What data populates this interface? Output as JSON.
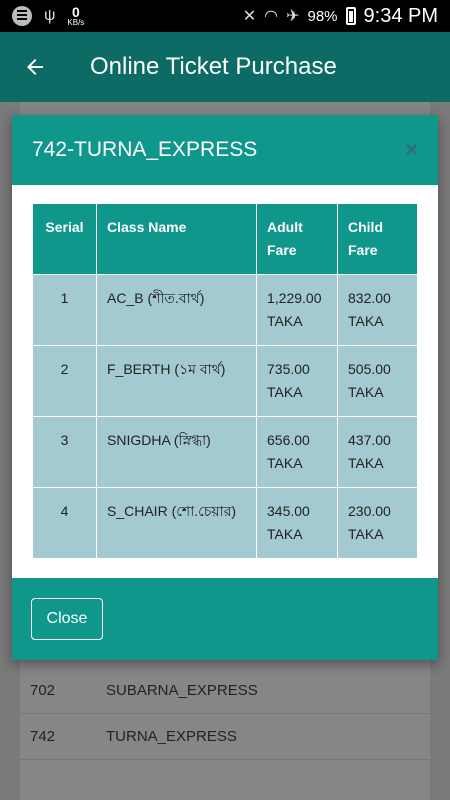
{
  "status_bar": {
    "data_speed_value": "0",
    "data_speed_unit": "KB/s",
    "battery": "98%",
    "time": "9:34 PM"
  },
  "app_bar": {
    "title": "Online Ticket Purchase"
  },
  "background_list": {
    "rows": [
      {
        "code": "702",
        "name": "SUBARNA_EXPRESS"
      },
      {
        "code": "742",
        "name": "TURNA_EXPRESS"
      }
    ]
  },
  "modal": {
    "title": "742-TURNA_EXPRESS",
    "close_x": "×",
    "table": {
      "headers": {
        "serial": "Serial",
        "class_name": "Class Name",
        "adult_fare": "Adult Fare",
        "child_fare": "Child Fare"
      },
      "rows": [
        {
          "serial": "1",
          "class_name": "AC_B (শীত.বার্থ)",
          "adult_fare": "1,229.00 TAKA",
          "child_fare": "832.00 TAKA"
        },
        {
          "serial": "2",
          "class_name": "F_BERTH (১ম বার্থ)",
          "adult_fare": "735.00 TAKA",
          "child_fare": "505.00 TAKA"
        },
        {
          "serial": "3",
          "class_name": "SNIGDHA (স্নিগ্ধা)",
          "adult_fare": "656.00 TAKA",
          "child_fare": "437.00 TAKA"
        },
        {
          "serial": "4",
          "class_name": "S_CHAIR (শো.চেয়ার)",
          "adult_fare": "345.00 TAKA",
          "child_fare": "230.00 TAKA"
        }
      ]
    },
    "close_button": "Close"
  }
}
